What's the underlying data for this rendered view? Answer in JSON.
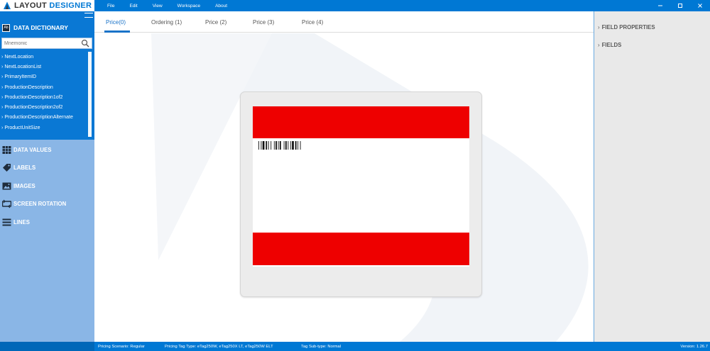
{
  "app": {
    "logo_word1": "LAYOUT",
    "logo_word2": "DESIGNER"
  },
  "menu": [
    "File",
    "Edit",
    "View",
    "Workspace",
    "About"
  ],
  "window_controls": {
    "minimize_icon": "minimize-icon",
    "maximize_icon": "maximize-icon",
    "close_icon": "close-icon"
  },
  "sidebar": {
    "data_dictionary": {
      "title": "DATA DICTIONARY",
      "icon_text": "Ab",
      "search_placeholder": "Mnemonic",
      "items": [
        "NextLocation",
        "NextLocationList",
        "PrimaryItemID",
        "ProductionDescription",
        "ProductionDescription1of2",
        "ProductionDescription2of2",
        "ProductionDescriptionAlternate",
        "ProductUnitSize"
      ]
    },
    "sections": [
      {
        "label": "DATA VALUES",
        "icon": "grid-icon"
      },
      {
        "label": "LABELS",
        "icon": "tag-icon"
      },
      {
        "label": "IMAGES",
        "icon": "image-icon"
      },
      {
        "label": "SCREEN ROTATION",
        "icon": "rotation-icon"
      },
      {
        "label": "LINES",
        "icon": "lines-icon"
      }
    ]
  },
  "tabs": [
    {
      "label": "Price(0)",
      "active": true
    },
    {
      "label": "Ordering (1)",
      "active": false
    },
    {
      "label": "Price (2)",
      "active": false
    },
    {
      "label": "Price (3)",
      "active": false
    },
    {
      "label": "Price (4)",
      "active": false
    }
  ],
  "canvas": {
    "accent_red": "#ee0000",
    "tag_color": "#ececec"
  },
  "right_panel": {
    "items": [
      "FIELD PROPERTIES",
      "FIELDS"
    ]
  },
  "status": {
    "scenario": "Pricing Scenario: Regular",
    "tag_type": "Pricing Tag Type: eTag250W, eTag250X LT, eTag250W ELT",
    "sub_type": "Tag Sub-type: Normal",
    "version": "Version: 1.26.7"
  },
  "colors": {
    "brand_blue": "#0078d4",
    "panel_light": "#8ab6e6"
  }
}
